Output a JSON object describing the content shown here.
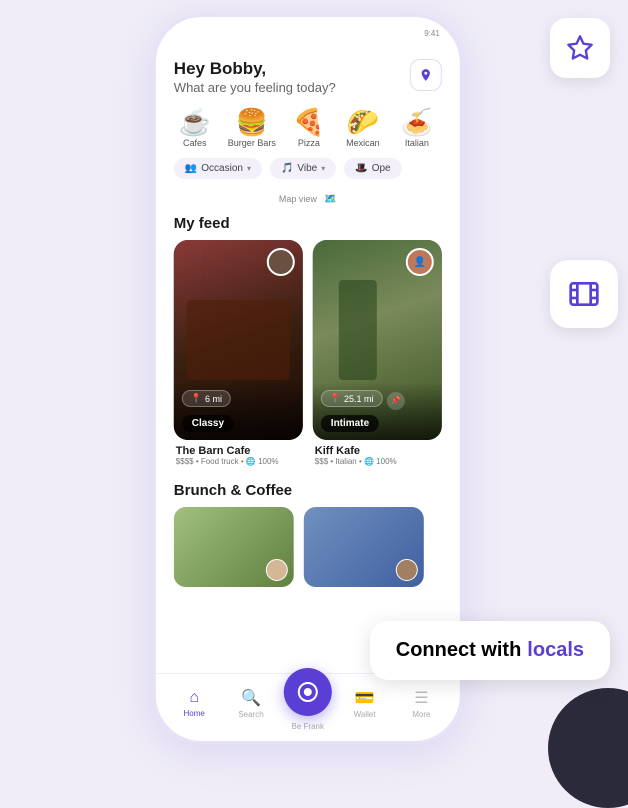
{
  "header": {
    "greeting": "Hey Bobby,",
    "subtitle": "What are you feeling today?"
  },
  "categories": [
    {
      "emoji": "☕",
      "label": "Cafes"
    },
    {
      "emoji": "🍔",
      "label": "Burger Bars"
    },
    {
      "emoji": "🍕",
      "label": "Pizza"
    },
    {
      "emoji": "🌮",
      "label": "Mexican"
    },
    {
      "emoji": "🍝",
      "label": "Italian"
    }
  ],
  "filters": [
    {
      "icon": "👥",
      "label": "Occasion",
      "has_chevron": true
    },
    {
      "icon": "🎵",
      "label": "Vibe",
      "has_chevron": true
    },
    {
      "icon": "🎩",
      "label": "Ope",
      "has_chevron": false
    }
  ],
  "map_view_label": "Map view",
  "feed": {
    "section_title": "My feed",
    "cards": [
      {
        "name": "The Barn Cafe",
        "distance": "6 mi",
        "vibe": "Classy",
        "price": "$$$$ • Food truck • 🌐 100%",
        "has_location_pin": false
      },
      {
        "name": "Kiff Kafe",
        "distance": "25.1 mi",
        "vibe": "Intimate",
        "price": "$$$ • Italian • 🌐 100%",
        "has_location_pin": true
      }
    ]
  },
  "brunch": {
    "section_title": "Brunch & Coffee"
  },
  "bottom_nav": [
    {
      "icon": "🏠",
      "label": "Home",
      "active": true
    },
    {
      "icon": "🔍",
      "label": "Search",
      "active": false
    },
    {
      "icon": "camera",
      "label": "Be Frank",
      "active": false,
      "is_center": true
    },
    {
      "icon": "💳",
      "label": "Wallet",
      "active": false
    },
    {
      "icon": "☰",
      "label": "More",
      "active": false
    }
  ],
  "float_star": {
    "label": "Star"
  },
  "float_film": {
    "label": "Film"
  },
  "connect_tooltip": {
    "prefix": "Connect with",
    "highlight": "locals"
  }
}
